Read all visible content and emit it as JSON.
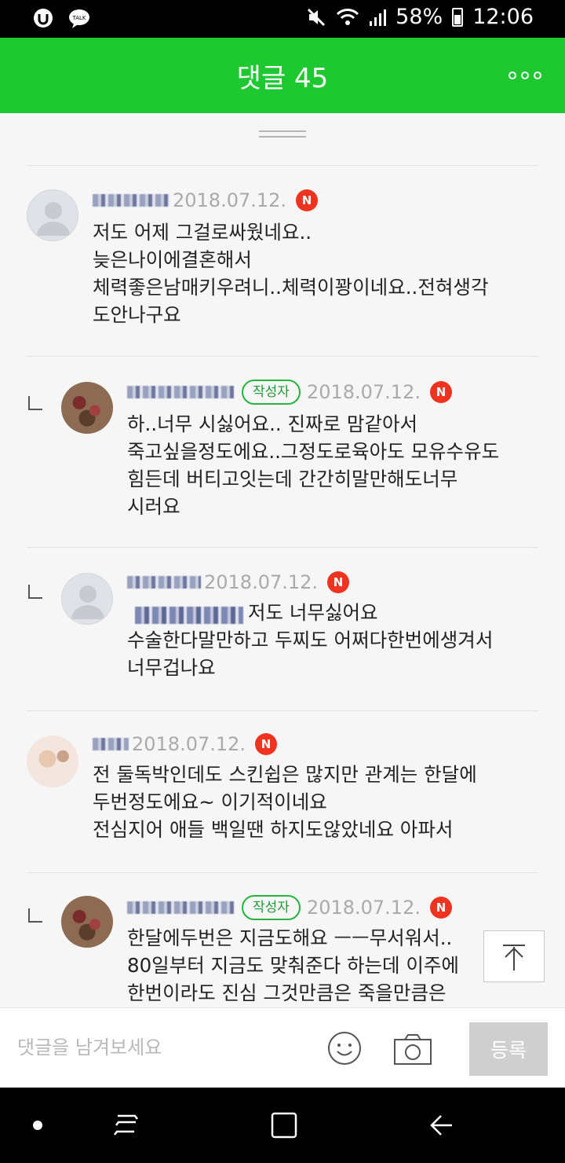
{
  "status_bar": {
    "battery": "58%",
    "time": "12:06",
    "icons": [
      "talk-circle-icon",
      "kakaotalk-icon",
      "mute-icon",
      "wifi-icon",
      "signal-icon",
      "battery-icon"
    ]
  },
  "header": {
    "title": "댓글 45",
    "more_icon": "more-dots-icon"
  },
  "colors": {
    "accent": "#1ec831",
    "new_badge": "#f0331f",
    "author_badge": "#26b33f"
  },
  "comments": [
    {
      "date": "2018.07.12.",
      "badge": "N",
      "text": "저도 어제 그걸로싸웠네요..\n늦은나이에결혼해서\n체력좋은남매키우려니..체력이꽝이네요..전혀생각\n도안나구요"
    },
    {
      "author_label": "작성자",
      "date": "2018.07.12.",
      "badge": "N",
      "text": "하..너무 시싫어요.. 진짜로 맘같아서\n죽고싶을정도에요..그정도로육아도 모유수유도\n힘든데 버티고잇는데 간간히말만해도너무\n시러요"
    },
    {
      "date": "2018.07.12.",
      "badge": "N",
      "text": "저도 너무싫어요\n수술한다말만하고 두찌도 어쩌다한번에생겨서\n너무겁나요"
    },
    {
      "date": "2018.07.12.",
      "badge": "N",
      "text": "전 둘독박인데도 스킨쉽은 많지만 관계는 한달에\n두번정도에요~ 이기적이네요\n전심지어 애들 백일땐 하지도않았네요 아파서"
    },
    {
      "author_label": "작성자",
      "date": "2018.07.12.",
      "badge": "N",
      "text": "한달에두번은 지금도해요 ㅡㅡ무서워서..\n80일부터 지금도 맞춰준다 하는데 이주에\n한번이라도 진심 그것만큼은 죽을만큼은"
    }
  ],
  "input": {
    "placeholder": "댓글을 남겨보세요",
    "submit_label": "등록"
  }
}
